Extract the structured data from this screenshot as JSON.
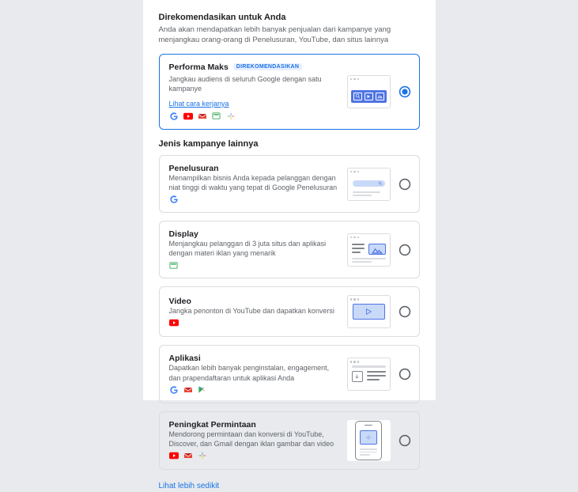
{
  "recommended": {
    "heading": "Direkomendasikan untuk Anda",
    "subtext": "Anda akan mendapatkan lebih banyak penjualan dari kampanye yang menjangkau orang-orang di Penelusuran, YouTube, dan situs lainnya"
  },
  "other_heading": "Jenis kampanye lainnya",
  "less_link": "Lihat lebih sedikit",
  "cards": {
    "pmax": {
      "title": "Performa Maks",
      "badge": "DIREKOMENDASIKAN",
      "desc": "Jangkau audiens di seluruh Google dengan satu kampanye",
      "link": "Lihat cara kerjanya",
      "selected": true
    },
    "search": {
      "title": "Penelusuran",
      "desc": "Menampilkan bisnis Anda kepada pelanggan dengan niat tinggi di waktu yang tepat di Google Penelusuran",
      "selected": false
    },
    "display": {
      "title": "Display",
      "desc": "Menjangkau pelanggan di 3 juta situs dan aplikasi dengan materi iklan yang menarik",
      "selected": false
    },
    "video": {
      "title": "Video",
      "desc": "Jangka penonton di YouTube dan dapatkan konversi",
      "selected": false
    },
    "app": {
      "title": "Aplikasi",
      "desc": "Dapatkan lebih banyak penginstalan, engagement, dan prapendaftaran untuk aplikasi Anda",
      "selected": false
    },
    "demand": {
      "title": "Peningkat Permintaan",
      "desc": "Mendorong permintaan dan konversi di YouTube, Discover, dan Gmail dengan iklan gambar dan video",
      "selected": false
    }
  }
}
